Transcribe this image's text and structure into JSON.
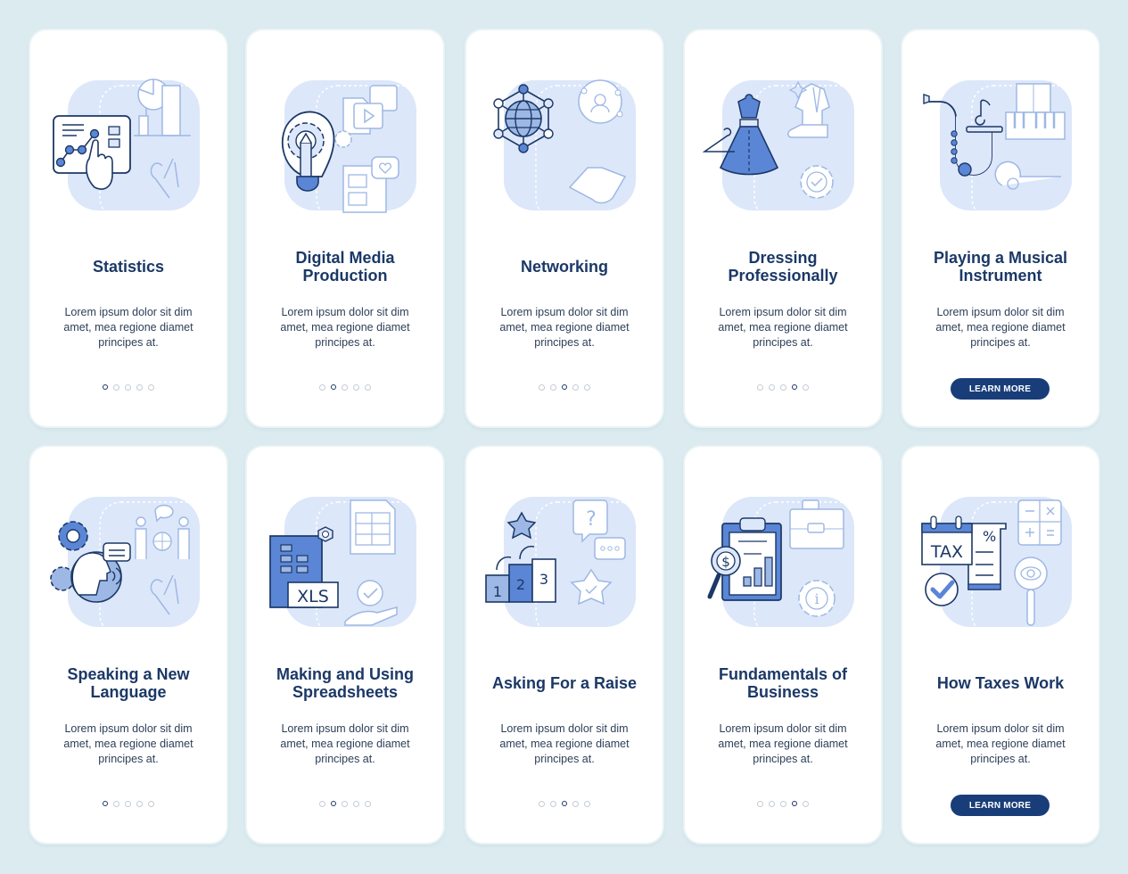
{
  "colors": {
    "background": "#dbebef",
    "card": "#ffffff",
    "title": "#1b3866",
    "body": "#2d3f58",
    "button": "#183d79",
    "accent": "#5b86d6",
    "light": "#dde7fa",
    "outline": "#9db8e4"
  },
  "cards": [
    {
      "title": "Statistics",
      "body": "Lorem ipsum dolor sit dim amet, mea regione diamet principes at.",
      "active_dot": 1,
      "illustration": "statistics-icon",
      "has_button": false
    },
    {
      "title": "Digital Media Production",
      "body": "Lorem ipsum dolor sit dim amet, mea regione diamet principes at.",
      "active_dot": 2,
      "illustration": "digital-media-icon",
      "has_button": false
    },
    {
      "title": "Networking",
      "body": "Lorem ipsum dolor sit dim amet, mea regione diamet principes at.",
      "active_dot": 3,
      "illustration": "networking-icon",
      "has_button": false
    },
    {
      "title": "Dressing Professionally",
      "body": "Lorem ipsum dolor sit dim amet, mea regione diamet principes at.",
      "active_dot": 4,
      "illustration": "dress-icon",
      "has_button": false
    },
    {
      "title": "Playing a Musical Instrument",
      "body": "Lorem ipsum dolor sit dim amet, mea regione diamet principes at.",
      "active_dot": 5,
      "illustration": "musical-instrument-icon",
      "has_button": true,
      "button_label": "LEARN MORE"
    },
    {
      "title": "Speaking a New Language",
      "body": "Lorem ipsum dolor sit dim amet, mea regione diamet principes at.",
      "active_dot": 1,
      "illustration": "language-icon",
      "has_button": false
    },
    {
      "title": "Making and Using Spreadsheets",
      "body": "Lorem ipsum dolor sit dim amet, mea regione diamet principes at.",
      "active_dot": 2,
      "illustration": "spreadsheet-icon",
      "has_button": false,
      "xls_label": "XLS"
    },
    {
      "title": "Asking For a Raise",
      "body": "Lorem ipsum dolor sit dim amet, mea regione diamet principes at.",
      "active_dot": 3,
      "illustration": "raise-icon",
      "has_button": false,
      "podium": [
        "1",
        "2",
        "3"
      ]
    },
    {
      "title": "Fundamentals of Business",
      "body": "Lorem ipsum dolor sit dim amet, mea regione diamet principes at.",
      "active_dot": 4,
      "illustration": "business-icon",
      "has_button": false,
      "currency": "$"
    },
    {
      "title": "How Taxes Work",
      "body": "Lorem ipsum dolor sit dim amet, mea regione diamet principes at.",
      "active_dot": 5,
      "illustration": "taxes-icon",
      "has_button": true,
      "button_label": "LEARN MORE",
      "tax_label": "TAX",
      "percent": "%"
    }
  ],
  "dot_count": 5
}
